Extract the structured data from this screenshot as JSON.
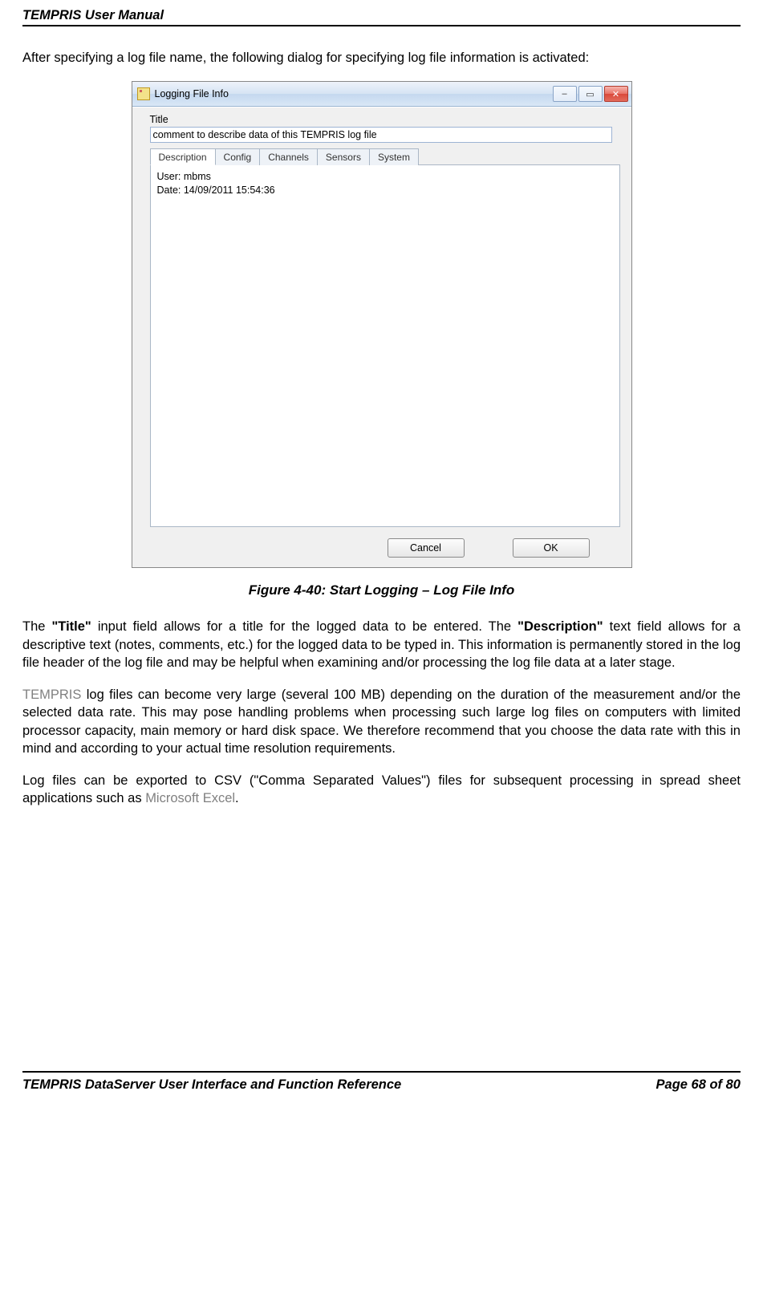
{
  "header": {
    "title": "TEMPRIS User Manual"
  },
  "intro": "After specifying a log file name, the following dialog for specifying log file information is activated:",
  "dialog": {
    "windowTitle": "Logging File Info",
    "titleLabel": "Title",
    "titleValue": "comment to describe data of this TEMPRIS log file",
    "tabs": [
      "Description",
      "Config",
      "Channels",
      "Sensors",
      "System"
    ],
    "descriptionContent": "User: mbms\nDate: 14/09/2011 15:54:36",
    "cancel": "Cancel",
    "ok": "OK"
  },
  "figureCaption": "Figure 4-40: Start Logging – Log File Info",
  "para1": {
    "t1": "The ",
    "b1": "\"Title\"",
    "t2": " input field allows for a title for the logged data to be entered. The ",
    "b2": "\"Description\"",
    "t3": " text field allows for a descriptive text (notes, comments, etc.) for the logged data to be typed in. This information is permanently stored in the log file header of the log file and may be helpful when examining and/or processing the log file data at a later stage."
  },
  "para2": {
    "brand": "TEMPRIS",
    "t": " log files can become very large (several 100 MB) depending on the duration of the measurement and/or the selected data rate. This may pose handling problems when processing such large log files on computers with limited processor capacity, main memory or hard disk space. We therefore recommend that you choose the data rate with this in mind and according to your actual time resolution requirements."
  },
  "para3": {
    "t1": "Log files can be exported to CSV (\"Comma Separated Values\") files for subsequent processing in spread sheet applications such as ",
    "brand": "Microsoft Excel",
    "t2": "."
  },
  "footer": {
    "left": "TEMPRIS DataServer User Interface and Function Reference",
    "right": "Page 68 of 80"
  }
}
